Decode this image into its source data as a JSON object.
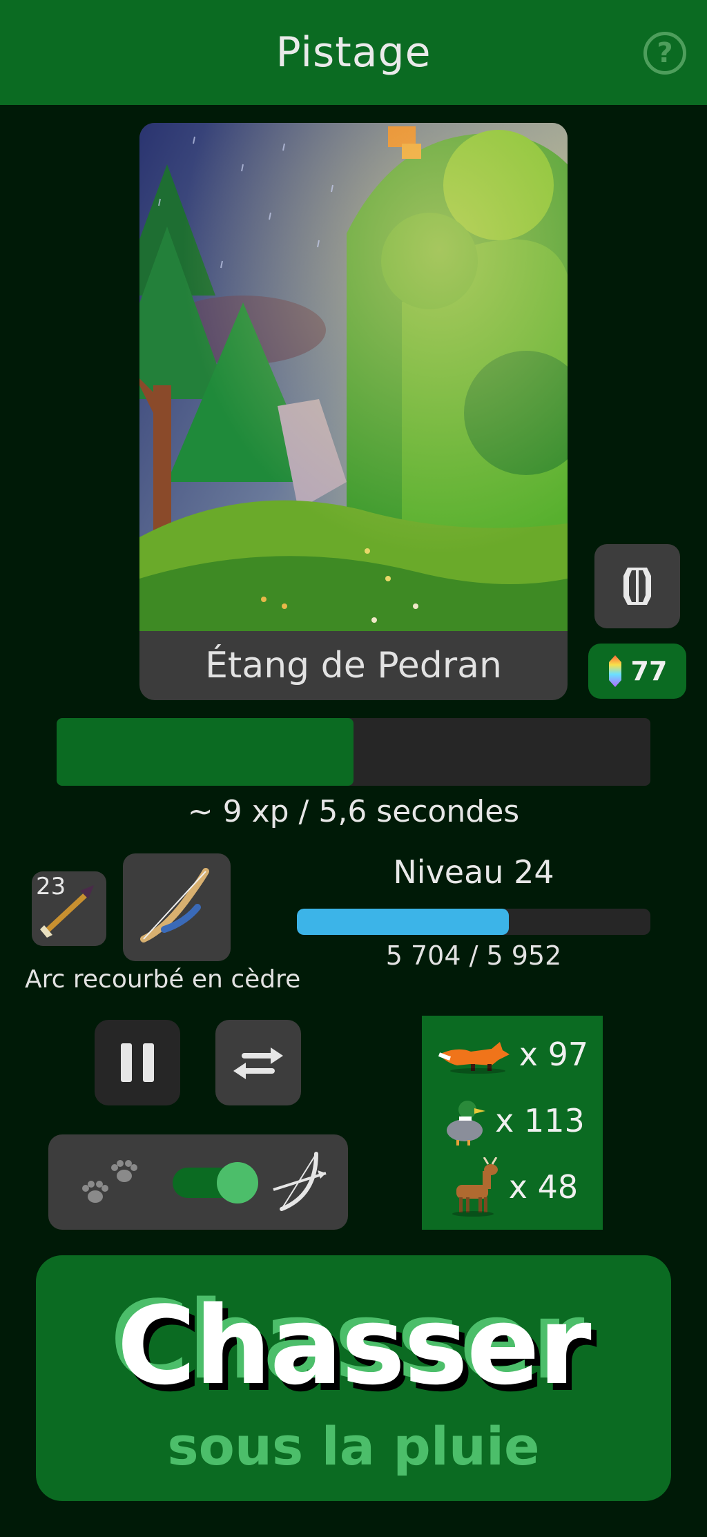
{
  "header": {
    "title": "Pistage",
    "help_icon": "?"
  },
  "location": {
    "name": "Étang de Pedran"
  },
  "crystals": {
    "count": "77"
  },
  "hunt_progress": {
    "fraction": 0.5
  },
  "rate_text": "~ 9 xp / 5,6 secondes",
  "ammo": {
    "count": "23",
    "icon": "arrow-icon"
  },
  "weapon": {
    "name": "Arc recourbé en cèdre",
    "icon": "recurve-bow-icon"
  },
  "level": {
    "title": "Niveau 24",
    "xp_text": "5 704 / 5 952",
    "fraction": 0.6
  },
  "controls": {
    "pause_icon": "pause-icon",
    "swap_icon": "swap-icon"
  },
  "mode": {
    "left_icon": "paw-prints-icon",
    "right_icon": "bow-icon",
    "toggle_on": true
  },
  "loot": [
    {
      "animal": "fox",
      "count": "x 97"
    },
    {
      "animal": "duck",
      "count": "x 113"
    },
    {
      "animal": "deer",
      "count": "x 48"
    }
  ],
  "action": {
    "title": "Chasser",
    "subtitle": "sous la pluie"
  },
  "colors": {
    "header": "#0b6b22",
    "background": "#001a07",
    "accent_green": "#4cbe6a",
    "xp_blue": "#3cb4e8"
  }
}
